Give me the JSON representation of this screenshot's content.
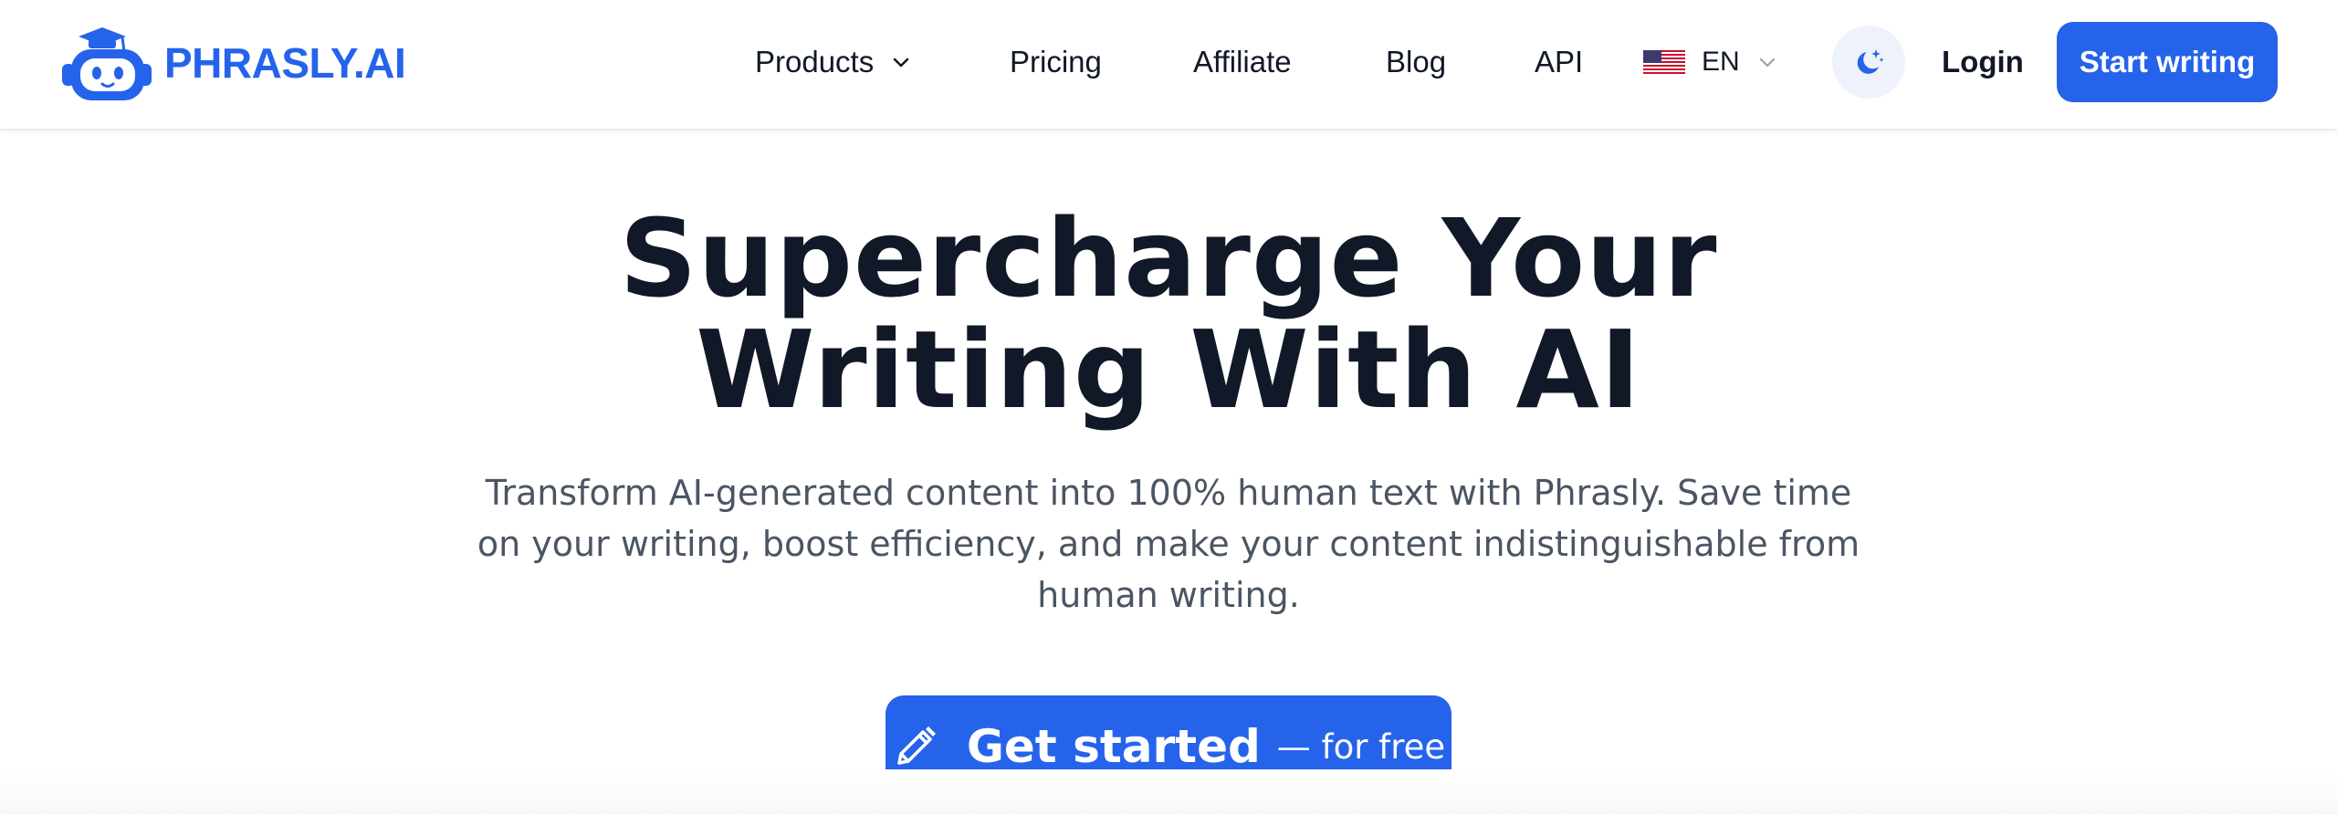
{
  "header": {
    "logo_text": "PHRASLY.AI",
    "nav": {
      "products": "Products",
      "pricing": "Pricing",
      "affiliate": "Affiliate",
      "blog": "Blog",
      "api": "API"
    },
    "language": {
      "code": "EN",
      "flag": "us-flag-icon"
    },
    "theme_toggle_icon": "moon-stars-icon",
    "login": "Login",
    "start_writing": "Start writing"
  },
  "hero": {
    "title_line1": "Supercharge Your",
    "title_line2": "Writing With AI",
    "subtitle": "Transform AI-generated content into 100% human text with Phrasly. Save time on your writing, boost efficiency, and make your content indistinguishable from human writing.",
    "cta_main": "Get started",
    "cta_sub": "— for free",
    "cta_icon": "pencil-icon"
  },
  "colors": {
    "brand": "#2563eb",
    "text": "#111827",
    "muted_text": "#4b5563",
    "theme_button_bg": "#eef2fb"
  }
}
